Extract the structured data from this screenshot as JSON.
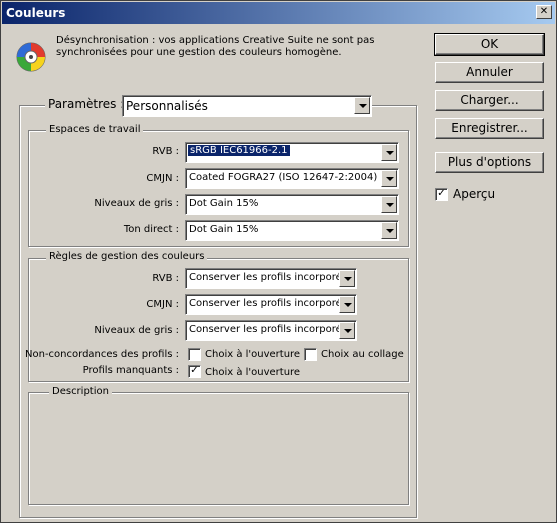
{
  "window": {
    "title": "Couleurs"
  },
  "info": {
    "text_line1": "Désynchronisation : vos applications Creative Suite ne sont pas",
    "text_line2": "synchronisées pour une gestion des couleurs homogène."
  },
  "buttons": {
    "ok": "OK",
    "cancel": "Annuler",
    "load": "Charger...",
    "save": "Enregistrer...",
    "more_options": "Plus d'options"
  },
  "preview": {
    "label": "Aperçu",
    "checked": true
  },
  "settings": {
    "label": "Paramètres :",
    "value": "Personnalisés"
  },
  "working_spaces": {
    "title": "Espaces de travail",
    "rows": [
      {
        "label": "RVB :",
        "value": "sRGB IEC61966-2.1"
      },
      {
        "label": "CMJN :",
        "value": "Coated FOGRA27 (ISO 12647-2:2004)"
      },
      {
        "label": "Niveaux de gris :",
        "value": "Dot Gain 15%"
      },
      {
        "label": "Ton direct :",
        "value": "Dot Gain 15%"
      }
    ]
  },
  "policies": {
    "title": "Règles de gestion des couleurs",
    "rows": [
      {
        "label": "RVB :",
        "value": "Conserver les profils incorporés"
      },
      {
        "label": "CMJN :",
        "value": "Conserver les profils incorporés"
      },
      {
        "label": "Niveaux de gris :",
        "value": "Conserver les profils incorporés"
      }
    ],
    "mismatch_label": "Non-concordances des profils :",
    "mismatch_open": "Choix à l'ouverture",
    "mismatch_open_checked": false,
    "mismatch_paste": "Choix au collage",
    "mismatch_paste_checked": false,
    "missing_label": "Profils manquants :",
    "missing_open": "Choix à l'ouverture",
    "missing_open_checked": true
  },
  "description": {
    "title": "Description",
    "text": ""
  },
  "colors": {
    "titlebar_start": "#0a246a",
    "titlebar_end": "#a6caf0",
    "face": "#d4d0c8",
    "highlight": "#0a246a"
  }
}
